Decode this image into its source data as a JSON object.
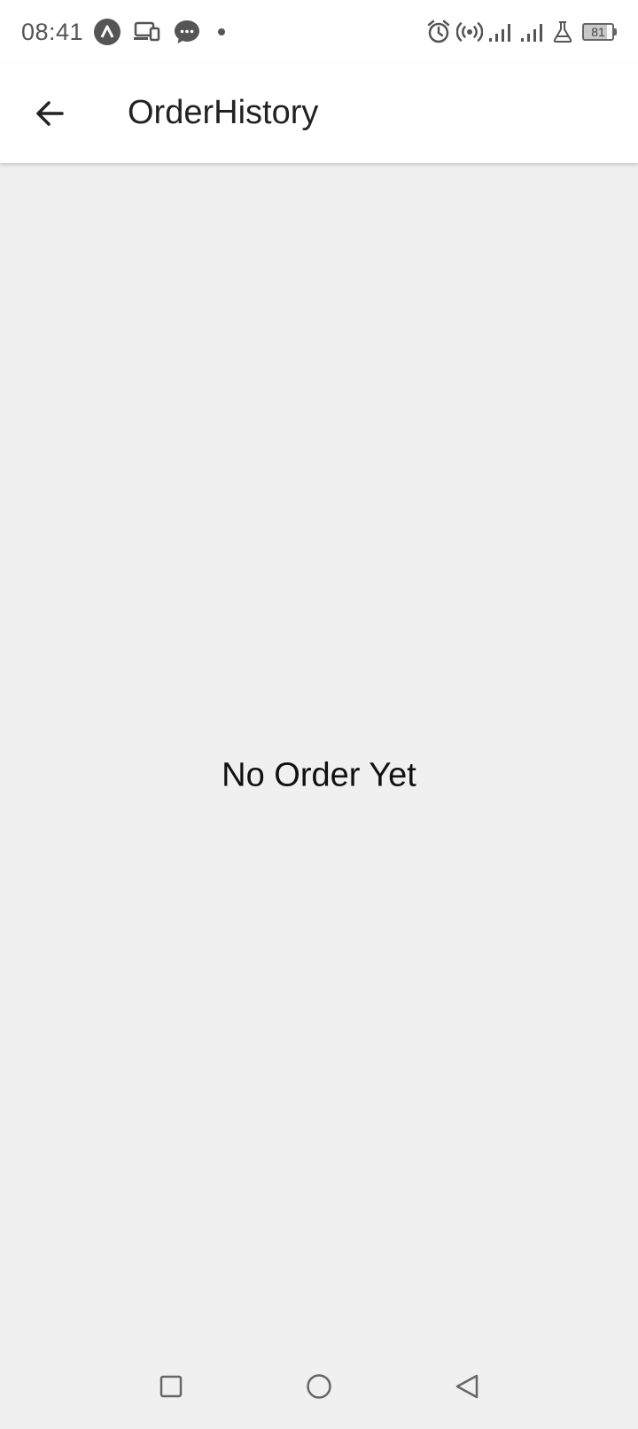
{
  "status_bar": {
    "time": "08:41",
    "battery_level": "81",
    "left_icons": [
      "navigation-icon",
      "cast-icon",
      "message-icon",
      "notification-dot-icon"
    ],
    "right_icons": [
      "alarm-icon",
      "hotspot-icon",
      "signal-icon",
      "signal-icon",
      "lab-icon",
      "battery-icon"
    ]
  },
  "app_bar": {
    "title": "OrderHistory",
    "back_icon": "arrow-left-icon"
  },
  "main": {
    "empty_message": "No Order Yet"
  },
  "nav_bar": {
    "buttons": [
      "recents-square-icon",
      "home-circle-icon",
      "back-triangle-icon"
    ]
  },
  "colors": {
    "background": "#f0f0f0",
    "app_bar": "#ffffff",
    "title_text": "#222222",
    "status_icons": "#555555"
  }
}
